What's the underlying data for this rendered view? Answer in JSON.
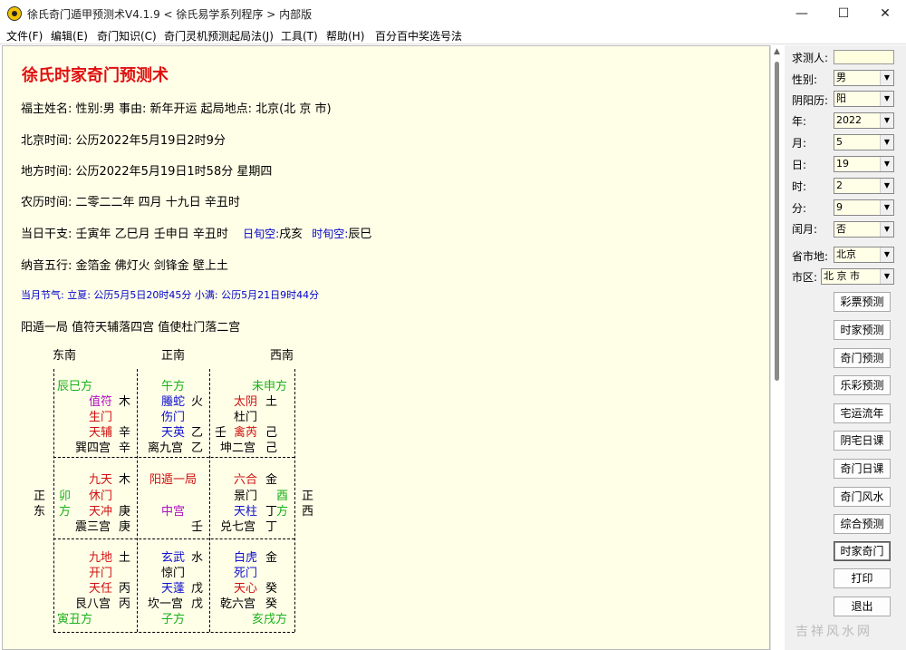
{
  "window": {
    "title": "徐氏奇门遁甲预测术V4.1.9  < 徐氏易学系列程序 > 内部版",
    "minimize": "—",
    "maximize": "☐",
    "close": "✕"
  },
  "menu": [
    "文件(F)",
    "编辑(E)",
    "奇门知识(C)",
    "奇门灵机预测起局法(J)",
    "工具(T)",
    "帮助(H)",
    "百分百中奖选号法"
  ],
  "main": {
    "heading": "徐氏时家奇门预测术",
    "line_person": "福主姓名:  性别:男  事由: 新年开运  起局地点: 北京(北 京 市)",
    "line_beijing": "北京时间: 公历2022年5月19日2时9分",
    "line_local": "地方时间: 公历2022年5月19日1时58分  星期四",
    "line_lunar": "农历时间: 二零二二年  四月  十九日  辛丑时",
    "line_ganzhi": "当日干支: 壬寅年  乙巳月  壬申日  辛丑时",
    "day_xunkong": "日旬空:",
    "day_xunkong_val": "戌亥",
    "hour_xunkong": "时旬空:",
    "hour_xunkong_val": "辰巳",
    "line_nayin": "纳音五行: 金箔金  佛灯火  剑锋金  壁上土",
    "line_jieqi": "当月节气: 立夏: 公历5月5日20时45分  小满: 公历5月21日9时44分",
    "line_ju": "阳遁一局  值符天辅落四宫  值使杜门落二宫"
  },
  "chart": {
    "top_labels": [
      "东南",
      "正南",
      "西南"
    ],
    "side_left": [
      "正",
      "东"
    ],
    "side_right": [
      "正",
      "西"
    ],
    "cells": [
      {
        "text": "辰巳方",
        "color": "green"
      },
      {
        "text": "午方",
        "color": "green"
      },
      {
        "text": "未申方",
        "color": "green"
      },
      {
        "text": "值符",
        "color": "purple"
      },
      {
        "text": "木",
        "color": "black"
      },
      {
        "text": "螣蛇",
        "color": "blue"
      },
      {
        "text": "火",
        "color": "black"
      },
      {
        "text": "太阴",
        "color": "red"
      },
      {
        "text": "土",
        "color": "black"
      },
      {
        "text": "生门",
        "color": "red"
      },
      {
        "text": "伤门",
        "color": "blue"
      },
      {
        "text": "杜门",
        "color": "black"
      },
      {
        "text": "天辅",
        "color": "red"
      },
      {
        "text": "辛",
        "color": "black"
      },
      {
        "text": "天英",
        "color": "blue"
      },
      {
        "text": "乙",
        "color": "black"
      },
      {
        "text": "壬",
        "color": "black"
      },
      {
        "text": "禽芮",
        "color": "red"
      },
      {
        "text": "己",
        "color": "black"
      },
      {
        "text": "巽四宫",
        "color": "black"
      },
      {
        "text": "辛",
        "color": "black"
      },
      {
        "text": "离九宫",
        "color": "black"
      },
      {
        "text": "乙",
        "color": "black"
      },
      {
        "text": "坤二宫",
        "color": "black"
      },
      {
        "text": "己",
        "color": "black"
      },
      {
        "text": "九天",
        "color": "red"
      },
      {
        "text": "木",
        "color": "black"
      },
      {
        "text": "阳遁一局",
        "color": "red"
      },
      {
        "text": "六合",
        "color": "red"
      },
      {
        "text": "金",
        "color": "black"
      },
      {
        "text": "卯",
        "color": "green"
      },
      {
        "text": "休门",
        "color": "red"
      },
      {
        "text": "景门",
        "color": "black"
      },
      {
        "text": "酉",
        "color": "green"
      },
      {
        "text": "方",
        "color": "green"
      },
      {
        "text": "天冲",
        "color": "red"
      },
      {
        "text": "庚",
        "color": "black"
      },
      {
        "text": "中宫",
        "color": "purple"
      },
      {
        "text": "天柱",
        "color": "blue"
      },
      {
        "text": "丁",
        "color": "black"
      },
      {
        "text": "方",
        "color": "green"
      },
      {
        "text": "震三宫",
        "color": "black"
      },
      {
        "text": "庚",
        "color": "black"
      },
      {
        "text": "壬",
        "color": "black"
      },
      {
        "text": "兑七宫",
        "color": "black"
      },
      {
        "text": "丁",
        "color": "black"
      },
      {
        "text": "九地",
        "color": "red"
      },
      {
        "text": "土",
        "color": "black"
      },
      {
        "text": "玄武",
        "color": "blue"
      },
      {
        "text": "水",
        "color": "black"
      },
      {
        "text": "白虎",
        "color": "blue"
      },
      {
        "text": "金",
        "color": "black"
      },
      {
        "text": "开门",
        "color": "red"
      },
      {
        "text": "惊门",
        "color": "black"
      },
      {
        "text": "死门",
        "color": "blue"
      },
      {
        "text": "天任",
        "color": "red"
      },
      {
        "text": "丙",
        "color": "black"
      },
      {
        "text": "天蓬",
        "color": "blue"
      },
      {
        "text": "戊",
        "color": "black"
      },
      {
        "text": "天心",
        "color": "red"
      },
      {
        "text": "癸",
        "color": "black"
      },
      {
        "text": "艮八宫",
        "color": "black"
      },
      {
        "text": "丙",
        "color": "black"
      },
      {
        "text": "坎一宫",
        "color": "black"
      },
      {
        "text": "戊",
        "color": "black"
      },
      {
        "text": "乾六宫",
        "color": "black"
      },
      {
        "text": "癸",
        "color": "black"
      },
      {
        "text": "寅丑方",
        "color": "green"
      },
      {
        "text": "子方",
        "color": "green"
      },
      {
        "text": "亥戌方",
        "color": "green"
      }
    ]
  },
  "panel": {
    "seeker_label": "求测人:",
    "seeker_value": "",
    "fields": [
      {
        "label": "性别:",
        "value": "男"
      },
      {
        "label": "阴阳历:",
        "value": "阳"
      },
      {
        "label": "年:",
        "value": "2022"
      },
      {
        "label": "月:",
        "value": "5"
      },
      {
        "label": "日:",
        "value": "19"
      },
      {
        "label": "时:",
        "value": "2"
      },
      {
        "label": "分:",
        "value": "9"
      },
      {
        "label": "闰月:",
        "value": "否"
      }
    ],
    "province_label": "省市地:",
    "province_value": "北京",
    "district_label": "市区:",
    "district_value": "北 京 市",
    "buttons": [
      "彩票预测",
      "时家预测",
      "奇门预测",
      "乐彩预测",
      "宅运流年",
      "阴宅日课",
      "奇门日课",
      "奇门风水",
      "综合预测",
      "时家奇门",
      "打印",
      "退出"
    ],
    "active_button": "时家奇门"
  },
  "watermark": "吉祥风水网"
}
